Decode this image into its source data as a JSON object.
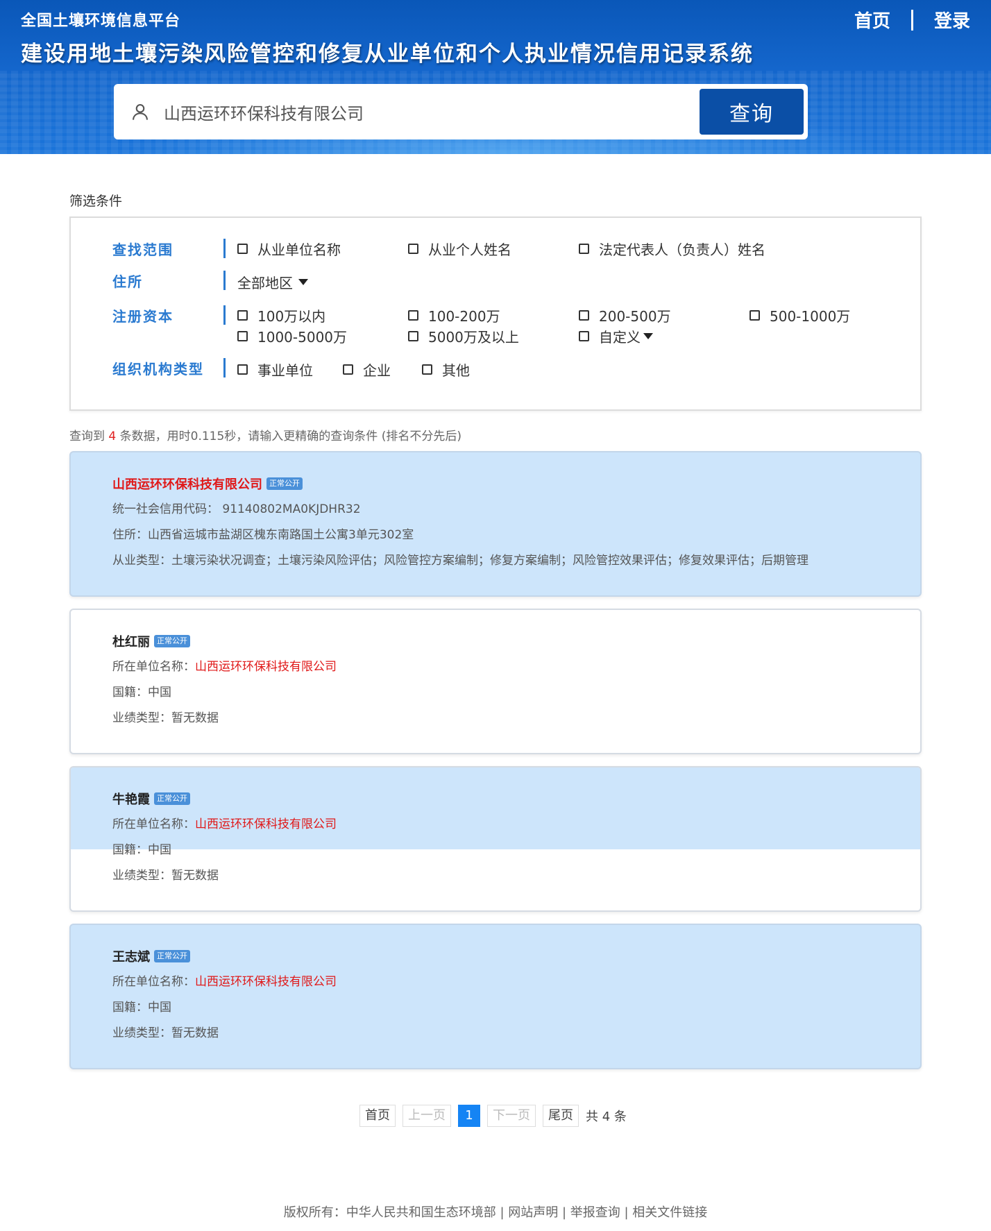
{
  "header": {
    "platform_title": "全国土壤环境信息平台",
    "system_title": "建设用地土壤污染风险管控和修复从业单位和个人执业情况信用记录系统",
    "nav": {
      "home": "首页",
      "separator": "|",
      "login": "登录"
    }
  },
  "search": {
    "icon": "user-icon",
    "value": "山西运环环保科技有限公司",
    "button_label": "查询"
  },
  "filter": {
    "heading": "筛选条件",
    "scope": {
      "label": "查找范围",
      "options": [
        "从业单位名称",
        "从业个人姓名",
        "法定代表人（负责人）姓名"
      ]
    },
    "address": {
      "label": "住所",
      "selected": "全部地区"
    },
    "capital": {
      "label": "注册资本",
      "options": [
        "100万以内",
        "100-200万",
        "200-500万",
        "500-1000万",
        "1000-5000万",
        "5000万及以上",
        "自定义"
      ]
    },
    "org_type": {
      "label": "组织机构类型",
      "options": [
        "事业单位",
        "企业",
        "其他"
      ]
    }
  },
  "summary": {
    "prefix": "查询到",
    "count": "4",
    "suffix": "条数据，用时0.115秒，请输入更精确的查询条件 (排名不分先后)"
  },
  "results": [
    {
      "title": "山西运环环保科技有限公司",
      "badge": "正常公开",
      "lines": [
        {
          "label": "统一社会信用代码：",
          "value": "91140802MA0KJDHR32"
        },
        {
          "label": "住所：",
          "value": "山西省运城市盐湖区槐东南路国土公寓3单元302室"
        },
        {
          "label": "从业类型：",
          "value": "土壤污染状况调查；土壤污染风险评估；风险管控方案编制；修复方案编制；风险管控效果评估；修复效果评估；后期管理"
        }
      ]
    },
    {
      "title": "杜红丽",
      "badge": "正常公开",
      "lines": [
        {
          "label": "所在单位名称：",
          "value": "山西运环环保科技有限公司"
        },
        {
          "label": "国籍：",
          "value": "中国"
        },
        {
          "label": "业绩类型：",
          "value": "暂无数据"
        }
      ]
    },
    {
      "title": "牛艳霞",
      "badge": "正常公开",
      "lines": [
        {
          "label": "所在单位名称：",
          "value": "山西运环环保科技有限公司"
        },
        {
          "label": "国籍：",
          "value": "中国"
        },
        {
          "label": "业绩类型：",
          "value": "暂无数据"
        }
      ]
    },
    {
      "title": "王志斌",
      "badge": "正常公开",
      "lines": [
        {
          "label": "所在单位名称：",
          "value": "山西运环环保科技有限公司"
        },
        {
          "label": "国籍：",
          "value": "中国"
        },
        {
          "label": "业绩类型：",
          "value": "暂无数据"
        }
      ]
    }
  ],
  "pagination": {
    "first": "首页",
    "prev": "上一页",
    "current": "1",
    "next": "下一页",
    "last": "尾页",
    "total": "共 4 条"
  },
  "footer": {
    "text": "版权所有：中华人民共和国生态环境部 | 网站声明 | 举报查询 | 相关文件链接"
  },
  "colors": {
    "header_blue": "#1466cc",
    "button_blue": "#0b4fa6",
    "label_blue": "#2a7ad0",
    "card_blue": "#cde5fb",
    "highlight_red": "#e01818",
    "page_active": "#1584f4"
  }
}
